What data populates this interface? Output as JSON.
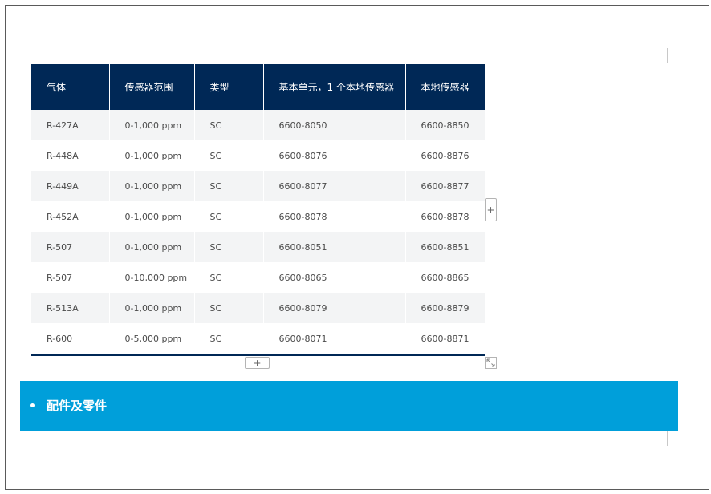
{
  "table": {
    "headers": [
      "气体",
      "传感器范围",
      "类型",
      "基本单元，1 个本地传感器",
      "本地传感器"
    ],
    "rows": [
      [
        "R-427A",
        "0-1,000 ppm",
        "SC",
        "6600-8050",
        "6600-8850"
      ],
      [
        "R-448A",
        "0-1,000 ppm",
        "SC",
        "6600-8076",
        "6600-8876"
      ],
      [
        "R-449A",
        "0-1,000 ppm",
        "SC",
        "6600-8077",
        "6600-8877"
      ],
      [
        "R-452A",
        "0-1,000 ppm",
        "SC",
        "6600-8078",
        "6600-8878"
      ],
      [
        "R-507",
        "0-1,000 ppm",
        "SC",
        "6600-8051",
        "6600-8851"
      ],
      [
        "R-507",
        "0-10,000 ppm",
        "SC",
        "6600-8065",
        "6600-8865"
      ],
      [
        "R-513A",
        "0-1,000 ppm",
        "SC",
        "6600-8079",
        "6600-8879"
      ],
      [
        "R-600",
        "0-5,000 ppm",
        "SC",
        "6600-8071",
        "6600-8871"
      ]
    ]
  },
  "controls": {
    "add_column_symbol": "+",
    "add_row_symbol": "+",
    "resize_icon": "resize-arrows-icon"
  },
  "section": {
    "bullet": "•",
    "title": "配件及零件"
  },
  "colors": {
    "header_bg": "#002856",
    "section_bg": "#009fda",
    "stripe_bg": "#f3f4f5"
  }
}
